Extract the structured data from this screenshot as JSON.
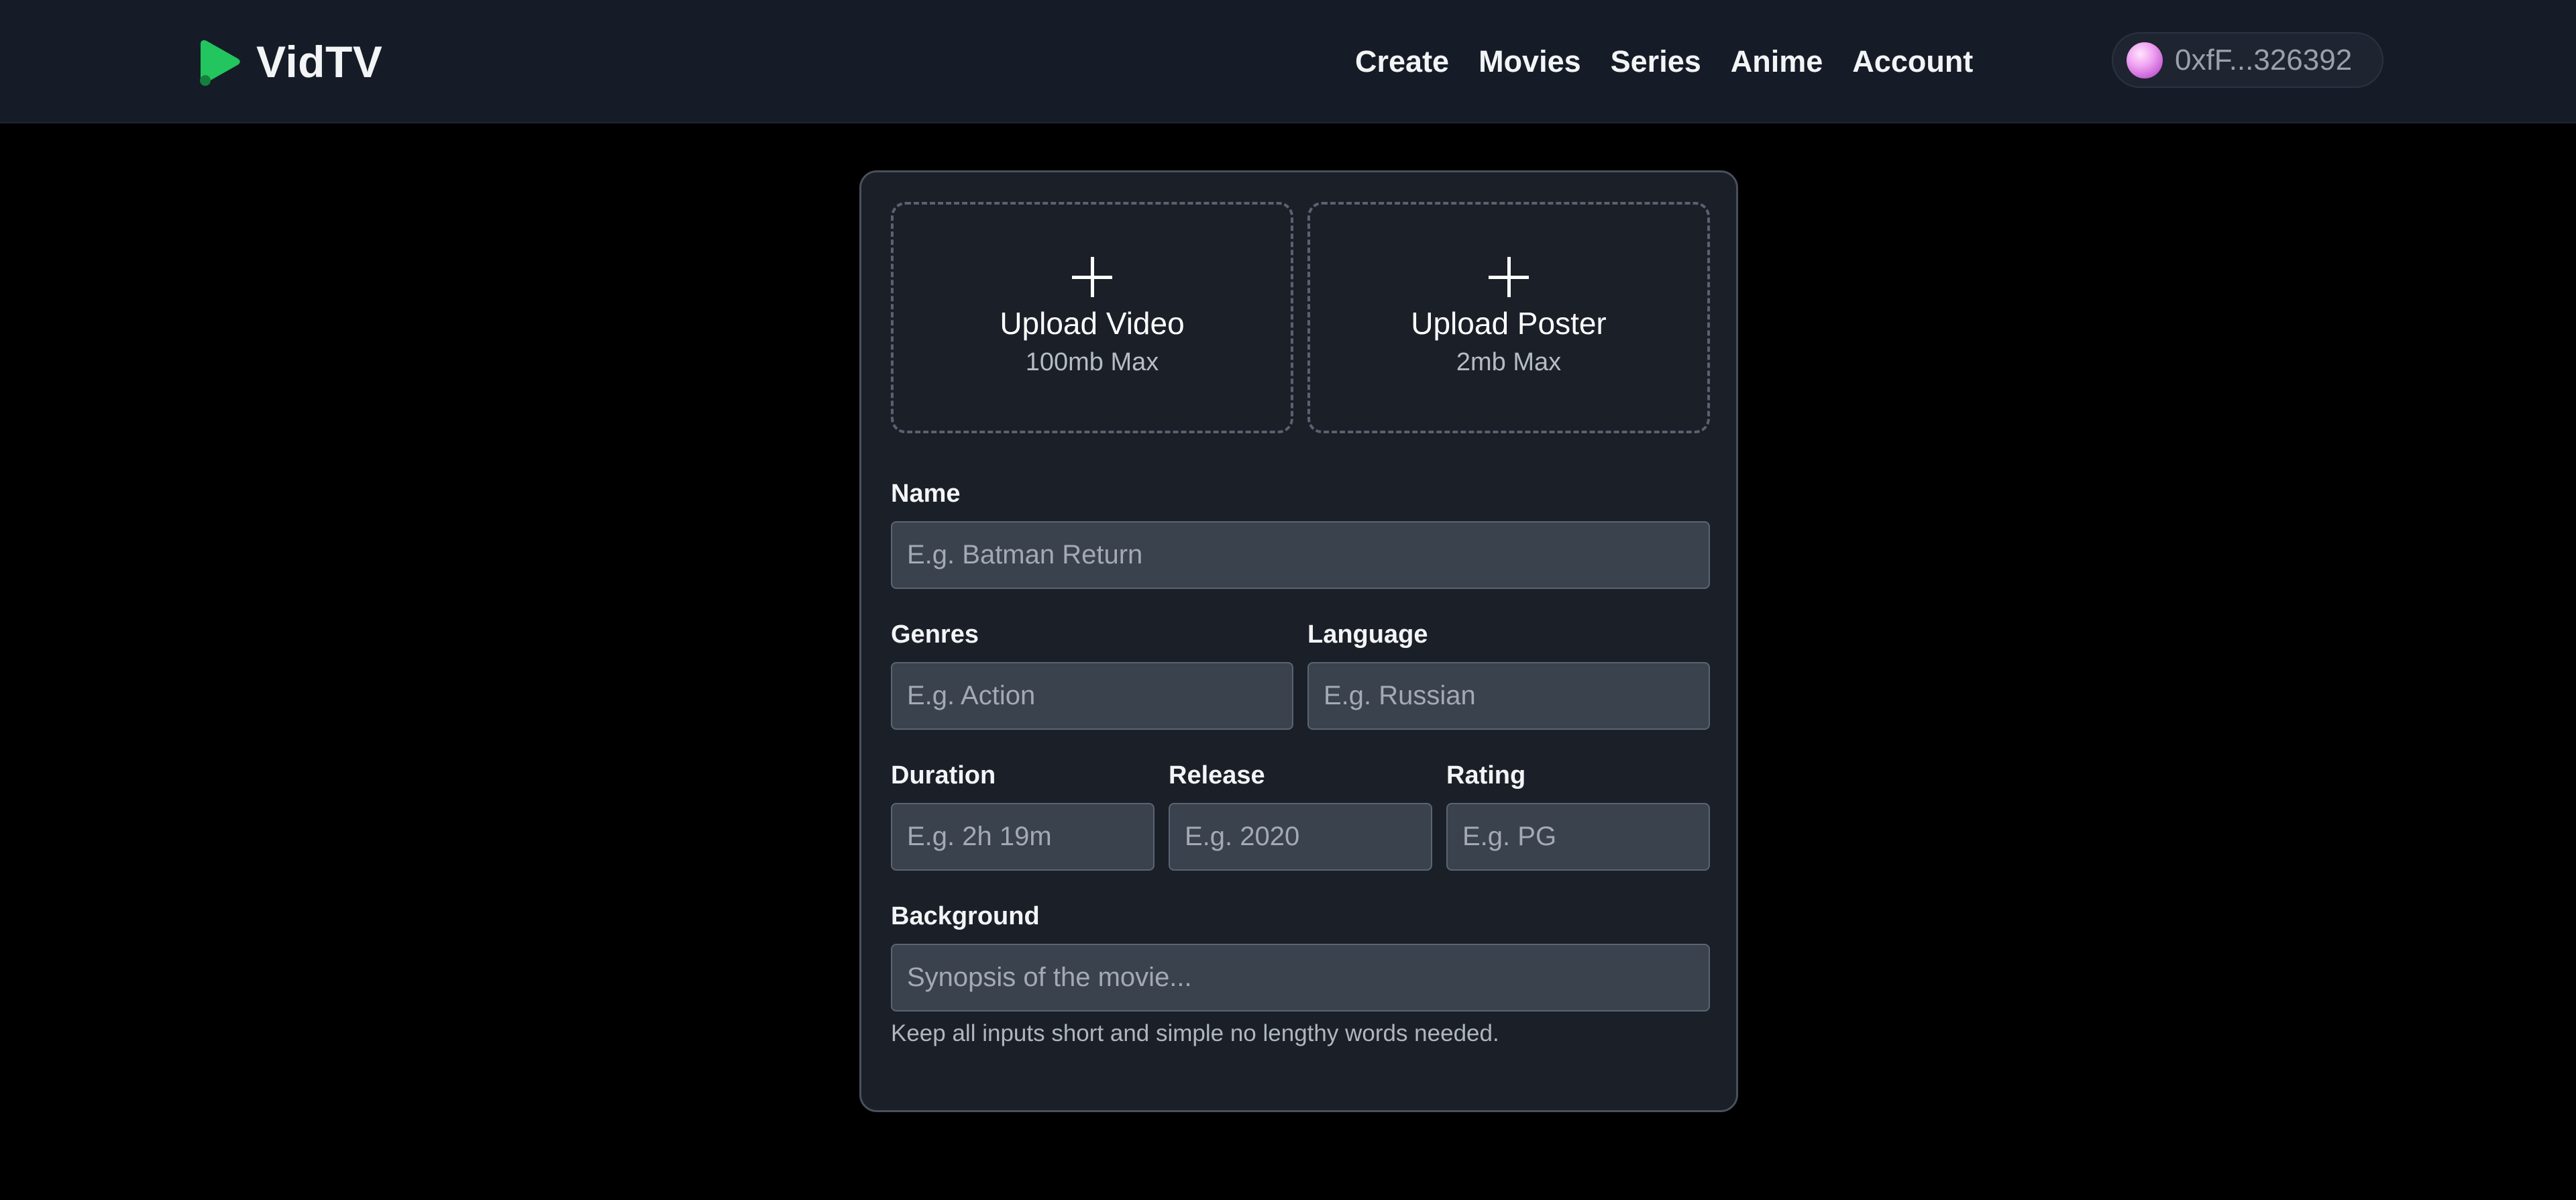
{
  "header": {
    "logo_text": "VidTV",
    "nav": [
      "Create",
      "Movies",
      "Series",
      "Anime",
      "Account"
    ],
    "wallet_address": "0xfF...326392"
  },
  "colors": {
    "brand_green": "#22c55e",
    "header_bg": "#161c27",
    "card_bg": "#1a1f28",
    "input_bg": "#3a424e"
  },
  "form": {
    "upload_video": {
      "title": "Upload Video",
      "limit": "100mb Max",
      "icon": "plus-icon"
    },
    "upload_poster": {
      "title": "Upload Poster",
      "limit": "2mb Max",
      "icon": "plus-icon"
    },
    "name": {
      "label": "Name",
      "placeholder": "E.g. Batman Return",
      "value": ""
    },
    "genres": {
      "label": "Genres",
      "placeholder": "E.g. Action",
      "value": ""
    },
    "language": {
      "label": "Language",
      "placeholder": "E.g. Russian",
      "value": ""
    },
    "duration": {
      "label": "Duration",
      "placeholder": "E.g. 2h 19m",
      "value": ""
    },
    "release": {
      "label": "Release",
      "placeholder": "E.g. 2020",
      "value": ""
    },
    "rating": {
      "label": "Rating",
      "placeholder": "E.g. PG",
      "value": ""
    },
    "background": {
      "label": "Background",
      "placeholder": "Synopsis of the movie...",
      "value": ""
    },
    "hint": "Keep all inputs short and simple no lengthy words needed."
  }
}
